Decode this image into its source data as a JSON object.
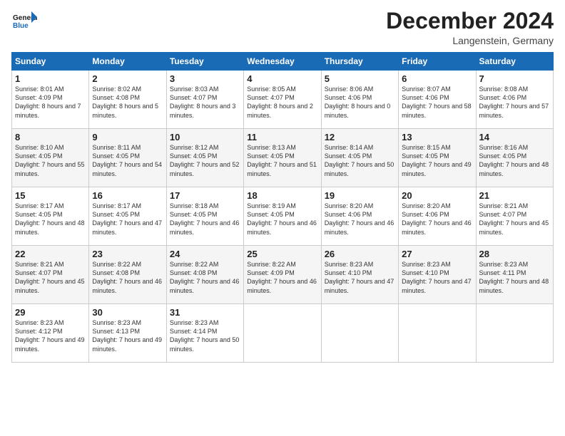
{
  "logo": {
    "line1": "General",
    "line2": "Blue"
  },
  "title": "December 2024",
  "subtitle": "Langenstein, Germany",
  "header_days": [
    "Sunday",
    "Monday",
    "Tuesday",
    "Wednesday",
    "Thursday",
    "Friday",
    "Saturday"
  ],
  "weeks": [
    [
      {
        "day": "1",
        "sunrise": "Sunrise: 8:01 AM",
        "sunset": "Sunset: 4:09 PM",
        "daylight": "Daylight: 8 hours and 7 minutes."
      },
      {
        "day": "2",
        "sunrise": "Sunrise: 8:02 AM",
        "sunset": "Sunset: 4:08 PM",
        "daylight": "Daylight: 8 hours and 5 minutes."
      },
      {
        "day": "3",
        "sunrise": "Sunrise: 8:03 AM",
        "sunset": "Sunset: 4:07 PM",
        "daylight": "Daylight: 8 hours and 3 minutes."
      },
      {
        "day": "4",
        "sunrise": "Sunrise: 8:05 AM",
        "sunset": "Sunset: 4:07 PM",
        "daylight": "Daylight: 8 hours and 2 minutes."
      },
      {
        "day": "5",
        "sunrise": "Sunrise: 8:06 AM",
        "sunset": "Sunset: 4:06 PM",
        "daylight": "Daylight: 8 hours and 0 minutes."
      },
      {
        "day": "6",
        "sunrise": "Sunrise: 8:07 AM",
        "sunset": "Sunset: 4:06 PM",
        "daylight": "Daylight: 7 hours and 58 minutes."
      },
      {
        "day": "7",
        "sunrise": "Sunrise: 8:08 AM",
        "sunset": "Sunset: 4:06 PM",
        "daylight": "Daylight: 7 hours and 57 minutes."
      }
    ],
    [
      {
        "day": "8",
        "sunrise": "Sunrise: 8:10 AM",
        "sunset": "Sunset: 4:05 PM",
        "daylight": "Daylight: 7 hours and 55 minutes."
      },
      {
        "day": "9",
        "sunrise": "Sunrise: 8:11 AM",
        "sunset": "Sunset: 4:05 PM",
        "daylight": "Daylight: 7 hours and 54 minutes."
      },
      {
        "day": "10",
        "sunrise": "Sunrise: 8:12 AM",
        "sunset": "Sunset: 4:05 PM",
        "daylight": "Daylight: 7 hours and 52 minutes."
      },
      {
        "day": "11",
        "sunrise": "Sunrise: 8:13 AM",
        "sunset": "Sunset: 4:05 PM",
        "daylight": "Daylight: 7 hours and 51 minutes."
      },
      {
        "day": "12",
        "sunrise": "Sunrise: 8:14 AM",
        "sunset": "Sunset: 4:05 PM",
        "daylight": "Daylight: 7 hours and 50 minutes."
      },
      {
        "day": "13",
        "sunrise": "Sunrise: 8:15 AM",
        "sunset": "Sunset: 4:05 PM",
        "daylight": "Daylight: 7 hours and 49 minutes."
      },
      {
        "day": "14",
        "sunrise": "Sunrise: 8:16 AM",
        "sunset": "Sunset: 4:05 PM",
        "daylight": "Daylight: 7 hours and 48 minutes."
      }
    ],
    [
      {
        "day": "15",
        "sunrise": "Sunrise: 8:17 AM",
        "sunset": "Sunset: 4:05 PM",
        "daylight": "Daylight: 7 hours and 48 minutes."
      },
      {
        "day": "16",
        "sunrise": "Sunrise: 8:17 AM",
        "sunset": "Sunset: 4:05 PM",
        "daylight": "Daylight: 7 hours and 47 minutes."
      },
      {
        "day": "17",
        "sunrise": "Sunrise: 8:18 AM",
        "sunset": "Sunset: 4:05 PM",
        "daylight": "Daylight: 7 hours and 46 minutes."
      },
      {
        "day": "18",
        "sunrise": "Sunrise: 8:19 AM",
        "sunset": "Sunset: 4:05 PM",
        "daylight": "Daylight: 7 hours and 46 minutes."
      },
      {
        "day": "19",
        "sunrise": "Sunrise: 8:20 AM",
        "sunset": "Sunset: 4:06 PM",
        "daylight": "Daylight: 7 hours and 46 minutes."
      },
      {
        "day": "20",
        "sunrise": "Sunrise: 8:20 AM",
        "sunset": "Sunset: 4:06 PM",
        "daylight": "Daylight: 7 hours and 46 minutes."
      },
      {
        "day": "21",
        "sunrise": "Sunrise: 8:21 AM",
        "sunset": "Sunset: 4:07 PM",
        "daylight": "Daylight: 7 hours and 45 minutes."
      }
    ],
    [
      {
        "day": "22",
        "sunrise": "Sunrise: 8:21 AM",
        "sunset": "Sunset: 4:07 PM",
        "daylight": "Daylight: 7 hours and 45 minutes."
      },
      {
        "day": "23",
        "sunrise": "Sunrise: 8:22 AM",
        "sunset": "Sunset: 4:08 PM",
        "daylight": "Daylight: 7 hours and 46 minutes."
      },
      {
        "day": "24",
        "sunrise": "Sunrise: 8:22 AM",
        "sunset": "Sunset: 4:08 PM",
        "daylight": "Daylight: 7 hours and 46 minutes."
      },
      {
        "day": "25",
        "sunrise": "Sunrise: 8:22 AM",
        "sunset": "Sunset: 4:09 PM",
        "daylight": "Daylight: 7 hours and 46 minutes."
      },
      {
        "day": "26",
        "sunrise": "Sunrise: 8:23 AM",
        "sunset": "Sunset: 4:10 PM",
        "daylight": "Daylight: 7 hours and 47 minutes."
      },
      {
        "day": "27",
        "sunrise": "Sunrise: 8:23 AM",
        "sunset": "Sunset: 4:10 PM",
        "daylight": "Daylight: 7 hours and 47 minutes."
      },
      {
        "day": "28",
        "sunrise": "Sunrise: 8:23 AM",
        "sunset": "Sunset: 4:11 PM",
        "daylight": "Daylight: 7 hours and 48 minutes."
      }
    ],
    [
      {
        "day": "29",
        "sunrise": "Sunrise: 8:23 AM",
        "sunset": "Sunset: 4:12 PM",
        "daylight": "Daylight: 7 hours and 49 minutes."
      },
      {
        "day": "30",
        "sunrise": "Sunrise: 8:23 AM",
        "sunset": "Sunset: 4:13 PM",
        "daylight": "Daylight: 7 hours and 49 minutes."
      },
      {
        "day": "31",
        "sunrise": "Sunrise: 8:23 AM",
        "sunset": "Sunset: 4:14 PM",
        "daylight": "Daylight: 7 hours and 50 minutes."
      },
      null,
      null,
      null,
      null
    ]
  ]
}
